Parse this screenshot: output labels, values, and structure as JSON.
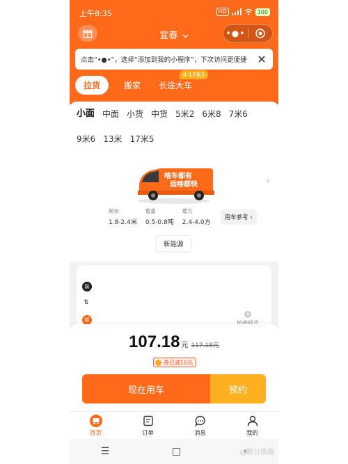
{
  "status_bar": {
    "time": "上午8:35",
    "signal_info": "HD",
    "battery": "100"
  },
  "nav": {
    "city": "宜春",
    "capsule_dots": "•●•"
  },
  "tip": {
    "text": "点击“•●•”，选择“添加到我的小程序”，下次访问更便捷"
  },
  "service_tabs": [
    {
      "label": "拉货"
    },
    {
      "label": "搬家"
    },
    {
      "label": "长途大车",
      "badge": "4-17米5"
    }
  ],
  "vehicle_sizes": [
    "小面",
    "中面",
    "小货",
    "中货",
    "5米2",
    "6米8",
    "7米6",
    "9米6",
    "13米",
    "17米5"
  ],
  "vehicle": {
    "slogan1": "啥车都有",
    "slogan2": "运啥都快",
    "specs": [
      {
        "label": "厢长",
        "value": "1.8-2.4米"
      },
      {
        "label": "载重",
        "value": "0.5-0.8吨"
      },
      {
        "label": "载方",
        "value": "2.4-4.0方"
      }
    ],
    "ref_label": "用车参考 ›",
    "energy_label": "新能源"
  },
  "address": {
    "load_dot": "装",
    "unload_dot": "卸",
    "swap": "⇅",
    "add_stop_label": "加途经点"
  },
  "price": {
    "amount": "107.18",
    "unit": "元",
    "original": "117.18元",
    "discount": "券已减10元"
  },
  "actions": {
    "now": "现在用车",
    "book": "预约"
  },
  "tabbar": [
    {
      "label": "首页",
      "icon": "home-icon"
    },
    {
      "label": "订单",
      "icon": "order-icon"
    },
    {
      "label": "消息",
      "icon": "message-icon"
    },
    {
      "label": "我的",
      "icon": "profile-icon"
    }
  ],
  "system_nav": {
    "menu": "☰",
    "home": "□",
    "back": "‹"
  },
  "watermark": "@朝日情趣",
  "colors": {
    "brand": "#ff6a1a",
    "accent": "#ffb020"
  }
}
